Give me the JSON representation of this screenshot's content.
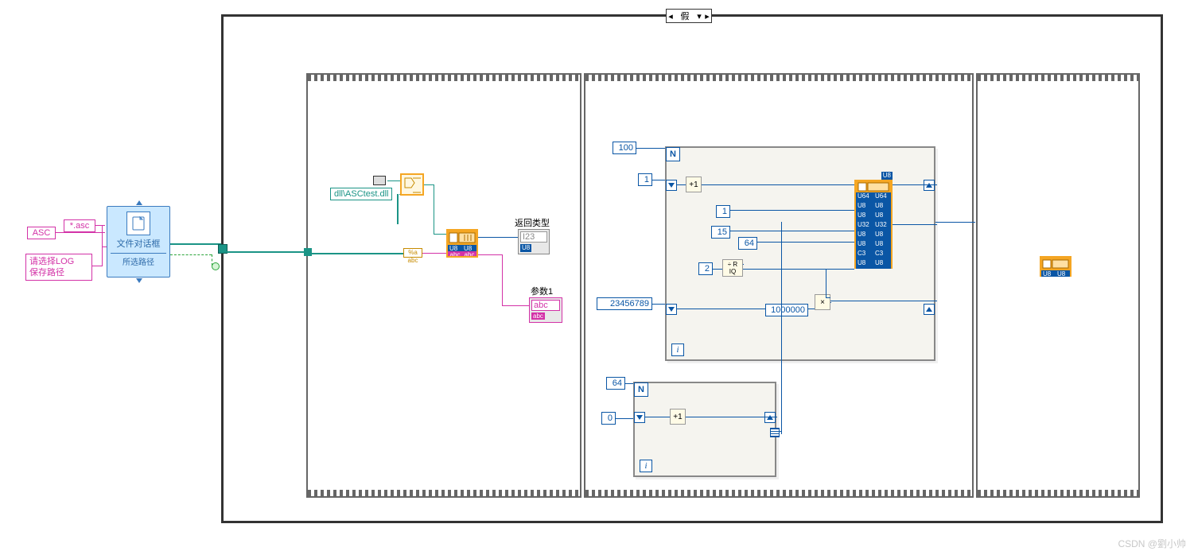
{
  "watermark": "CSDN @劉小帅",
  "case": {
    "selector": "假"
  },
  "inputs": {
    "asc_filter": "ASC",
    "asc_ext": "*.asc",
    "prompt_line1": "请选择LOG",
    "prompt_line2": "保存路径"
  },
  "expr_node": {
    "title": "文件对话框",
    "footer": "所选路径"
  },
  "frame1": {
    "dll_path": "dll\\ASCtest.dll",
    "call_lib": {
      "abc1": "abc",
      "abc2": "abc",
      "u8": "U8"
    },
    "return_label": "返回类型",
    "return_tag": "U8",
    "return_placeholder": "I23",
    "param1_label": "参数1",
    "param1_tag": "abc",
    "param1_placeholder": "abc"
  },
  "frame2": {
    "loop1": {
      "N_init": "100",
      "shift_init": "1",
      "c1": "1",
      "c15": "15",
      "c64": "64",
      "c2": "2",
      "c1000000": "1000000",
      "c23456789": "23456789",
      "inc_text": "+1",
      "qr_top": "R",
      "qr_bot": "IQ",
      "qr_div": "÷"
    },
    "loop2": {
      "N_init": "64",
      "shift_init": "0",
      "inc_text": "+1"
    },
    "cluster_rows": [
      [
        "U64",
        "U64"
      ],
      [
        "U8",
        "U8"
      ],
      [
        "U8",
        "U8"
      ],
      [
        "U32",
        "U32"
      ],
      [
        "U8",
        "U8"
      ],
      [
        "U8",
        "U8"
      ],
      [
        "C3",
        "C3"
      ],
      [
        "U8",
        "U8"
      ]
    ],
    "cluster_tag": "U8"
  },
  "frame3": {
    "call_tag": "U8"
  }
}
